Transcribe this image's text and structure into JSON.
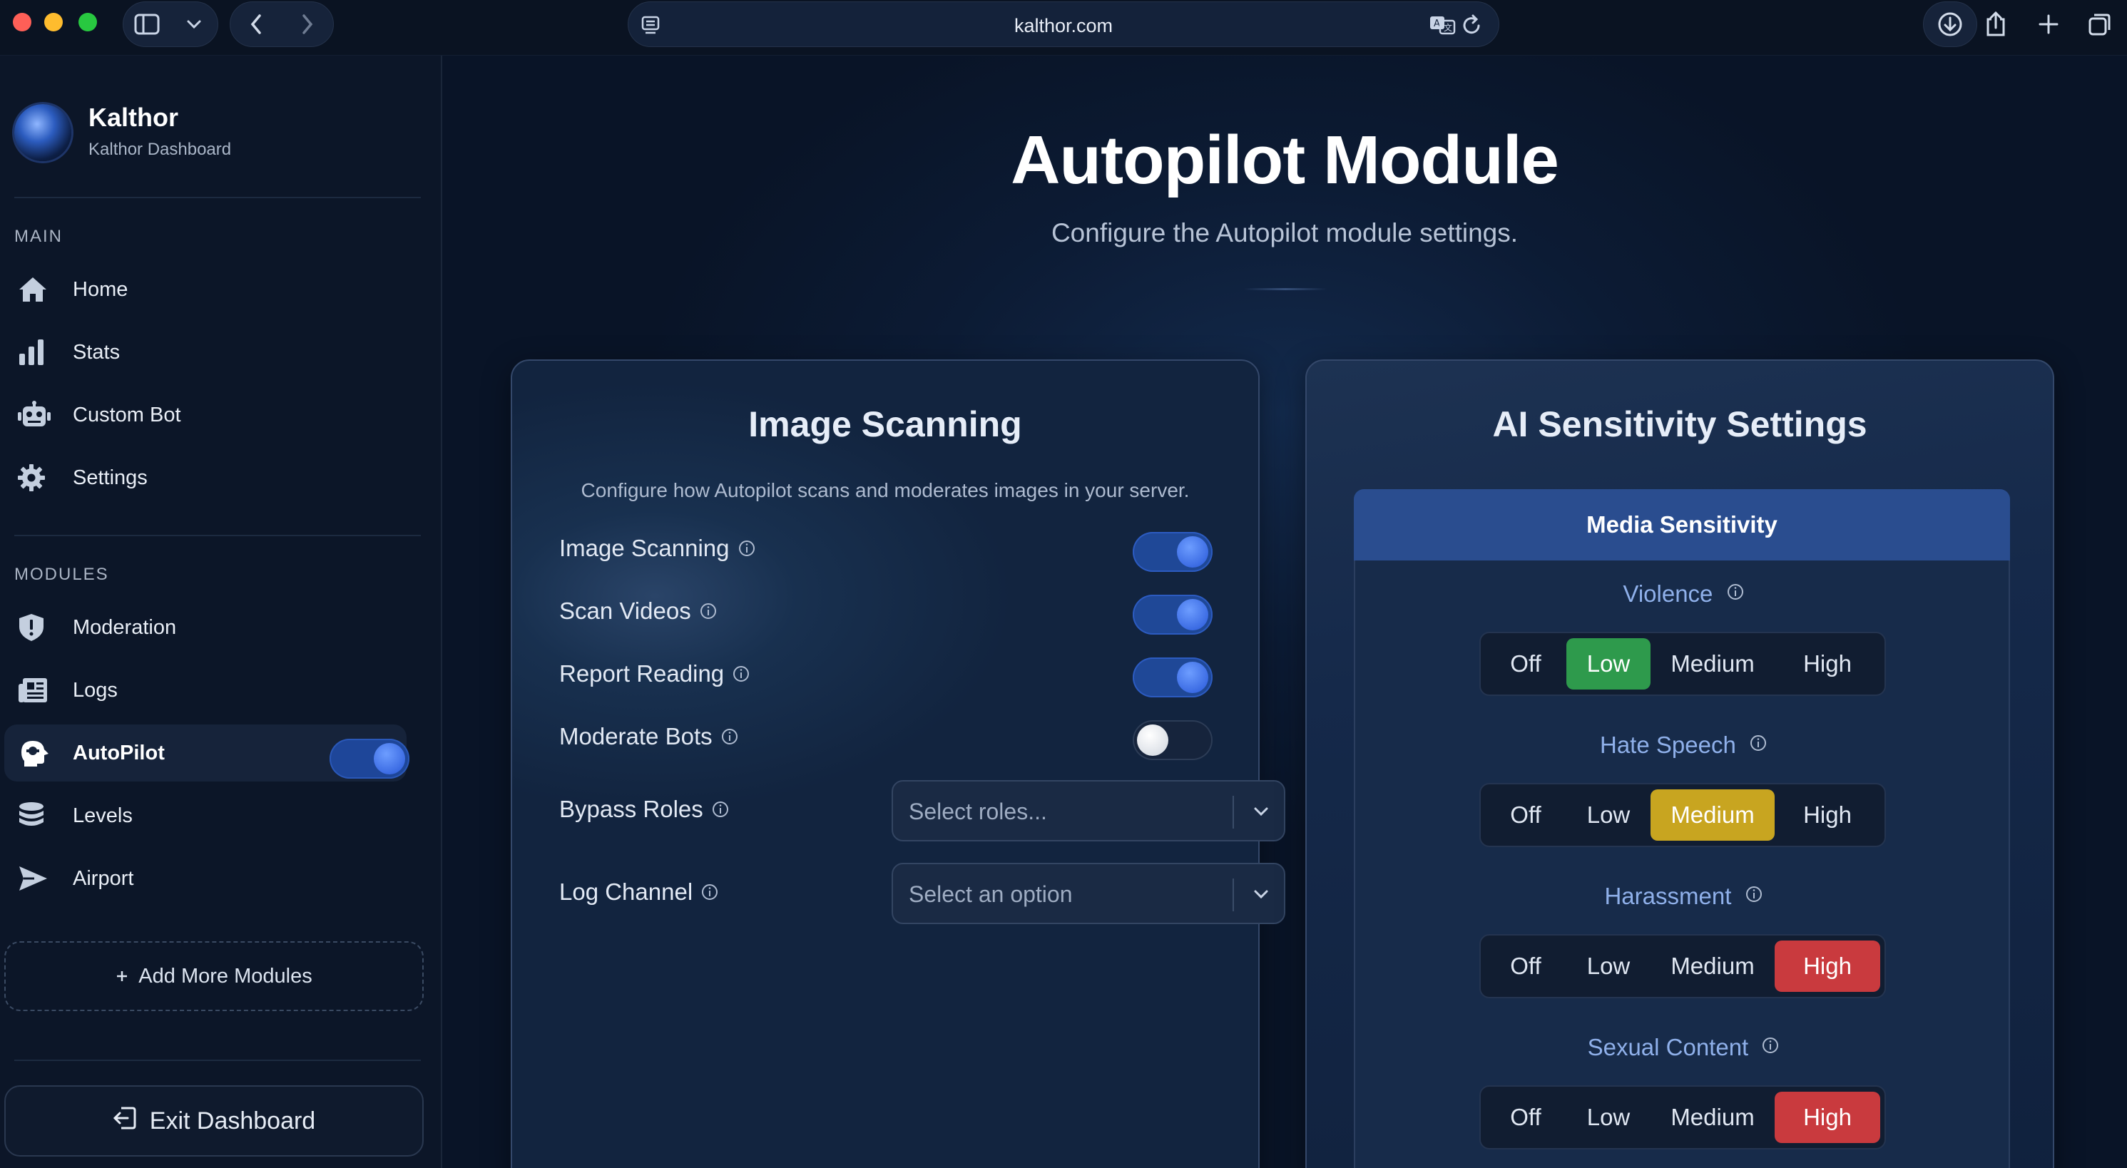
{
  "browser": {
    "url": "kalthor.com"
  },
  "sidebar": {
    "brand_name": "Kalthor",
    "brand_subtitle": "Kalthor Dashboard",
    "main_label": "MAIN",
    "main_items": [
      {
        "label": "Home",
        "icon": "home-icon"
      },
      {
        "label": "Stats",
        "icon": "stats-icon"
      },
      {
        "label": "Custom Bot",
        "icon": "robot-icon"
      },
      {
        "label": "Settings",
        "icon": "gear-icon"
      }
    ],
    "modules_label": "MODULES",
    "module_items": [
      {
        "label": "Moderation",
        "icon": "shield-icon"
      },
      {
        "label": "Logs",
        "icon": "logs-icon"
      },
      {
        "label": "AutoPilot",
        "icon": "autopilot-icon",
        "active": true,
        "enabled": true
      },
      {
        "label": "Levels",
        "icon": "levels-icon"
      },
      {
        "label": "Airport",
        "icon": "plane-icon"
      }
    ],
    "add_modules": "Add More Modules",
    "exit": "Exit Dashboard"
  },
  "page": {
    "title": "Autopilot Module",
    "subtitle": "Configure the Autopilot module settings."
  },
  "image_scanning": {
    "title": "Image Scanning",
    "description": "Configure how Autopilot scans and moderates images in your server.",
    "toggles": [
      {
        "label": "Image Scanning",
        "on": true
      },
      {
        "label": "Scan Videos",
        "on": true
      },
      {
        "label": "Report Reading",
        "on": true
      },
      {
        "label": "Moderate Bots",
        "on": false
      }
    ],
    "bypass_roles": {
      "label": "Bypass Roles",
      "placeholder": "Select roles..."
    },
    "log_channel": {
      "label": "Log Channel",
      "placeholder": "Select an option"
    }
  },
  "ai_sensitivity": {
    "title": "AI Sensitivity Settings",
    "tab": "Media Sensitivity",
    "options": [
      "Off",
      "Low",
      "Medium",
      "High"
    ],
    "categories": [
      {
        "label": "Violence",
        "selected": "Low"
      },
      {
        "label": "Hate Speech",
        "selected": "Medium"
      },
      {
        "label": "Harassment",
        "selected": "High"
      },
      {
        "label": "Sexual Content",
        "selected": "High"
      }
    ]
  },
  "colors": {
    "low": "#2e9a4c",
    "medium": "#c8a520",
    "high": "#c93a3e",
    "accent": "#2a4d8f"
  }
}
